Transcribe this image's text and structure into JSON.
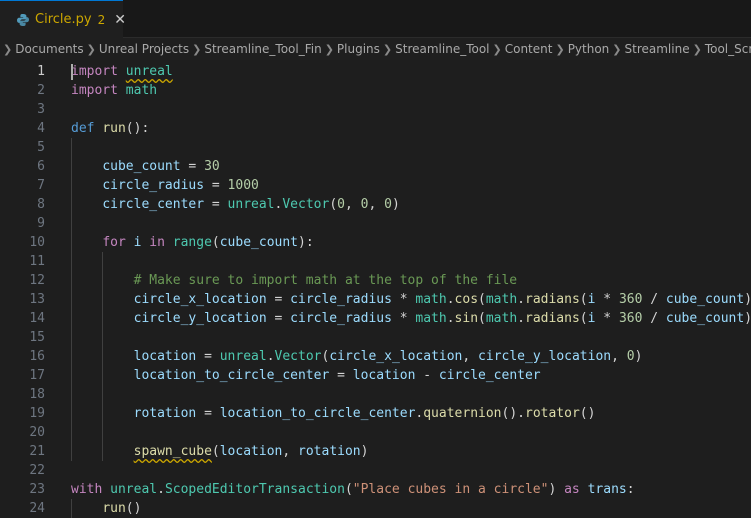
{
  "tab": {
    "filename": "Circle.py",
    "problem_count": "2",
    "close_glyph": "✕",
    "icon": "python-icon"
  },
  "breadcrumb": [
    "Documents",
    "Unreal Projects",
    "Streamline_Tool_Fin",
    "Plugins",
    "Streamline_Tool",
    "Content",
    "Python",
    "Streamline",
    "Tool_Script_I"
  ],
  "colors": {
    "keyword": "#c586c0",
    "def": "#569cd6",
    "function": "#dcdcaa",
    "variable": "#9cdcfe",
    "number": "#b5cea8",
    "string": "#ce9178",
    "comment": "#6a9955",
    "module": "#4ec9b0",
    "warning": "#cca700"
  },
  "lines": [
    {
      "no": "1",
      "indent": 0,
      "tokens": [
        [
          "k",
          "import"
        ],
        [
          "t",
          " "
        ],
        [
          "m",
          "unreal",
          "sq"
        ]
      ]
    },
    {
      "no": "2",
      "indent": 0,
      "tokens": [
        [
          "k",
          "import"
        ],
        [
          "t",
          " "
        ],
        [
          "m",
          "math"
        ]
      ]
    },
    {
      "no": "3",
      "indent": 0,
      "tokens": []
    },
    {
      "no": "4",
      "indent": 0,
      "tokens": [
        [
          "kd",
          "def"
        ],
        [
          "t",
          " "
        ],
        [
          "f",
          "run"
        ],
        [
          "t",
          "():"
        ]
      ]
    },
    {
      "no": "5",
      "indent": 1,
      "tokens": []
    },
    {
      "no": "6",
      "indent": 1,
      "tokens": [
        [
          "v",
          "cube_count"
        ],
        [
          "t",
          " = "
        ],
        [
          "n",
          "30"
        ]
      ]
    },
    {
      "no": "7",
      "indent": 1,
      "tokens": [
        [
          "v",
          "circle_radius"
        ],
        [
          "t",
          " = "
        ],
        [
          "n",
          "1000"
        ]
      ]
    },
    {
      "no": "8",
      "indent": 1,
      "tokens": [
        [
          "v",
          "circle_center"
        ],
        [
          "t",
          " = "
        ],
        [
          "m",
          "unreal"
        ],
        [
          "t",
          "."
        ],
        [
          "m",
          "Vector"
        ],
        [
          "t",
          "("
        ],
        [
          "n",
          "0"
        ],
        [
          "t",
          ", "
        ],
        [
          "n",
          "0"
        ],
        [
          "t",
          ", "
        ],
        [
          "n",
          "0"
        ],
        [
          "t",
          ")"
        ]
      ]
    },
    {
      "no": "9",
      "indent": 1,
      "tokens": []
    },
    {
      "no": "10",
      "indent": 1,
      "tokens": [
        [
          "k",
          "for"
        ],
        [
          "t",
          " "
        ],
        [
          "v",
          "i"
        ],
        [
          "t",
          " "
        ],
        [
          "k",
          "in"
        ],
        [
          "t",
          " "
        ],
        [
          "m",
          "range"
        ],
        [
          "t",
          "("
        ],
        [
          "v",
          "cube_count"
        ],
        [
          "t",
          "):"
        ]
      ]
    },
    {
      "no": "11",
      "indent": 2,
      "tokens": []
    },
    {
      "no": "12",
      "indent": 2,
      "tokens": [
        [
          "c",
          "# Make sure to import math at the top of the file"
        ]
      ]
    },
    {
      "no": "13",
      "indent": 2,
      "tokens": [
        [
          "v",
          "circle_x_location"
        ],
        [
          "t",
          " = "
        ],
        [
          "v",
          "circle_radius"
        ],
        [
          "t",
          " * "
        ],
        [
          "m",
          "math"
        ],
        [
          "t",
          "."
        ],
        [
          "f",
          "cos"
        ],
        [
          "t",
          "("
        ],
        [
          "m",
          "math"
        ],
        [
          "t",
          "."
        ],
        [
          "f",
          "radians"
        ],
        [
          "t",
          "("
        ],
        [
          "v",
          "i"
        ],
        [
          "t",
          " * "
        ],
        [
          "n",
          "360"
        ],
        [
          "t",
          " / "
        ],
        [
          "v",
          "cube_count"
        ],
        [
          "t",
          "))"
        ]
      ]
    },
    {
      "no": "14",
      "indent": 2,
      "tokens": [
        [
          "v",
          "circle_y_location"
        ],
        [
          "t",
          " = "
        ],
        [
          "v",
          "circle_radius"
        ],
        [
          "t",
          " * "
        ],
        [
          "m",
          "math"
        ],
        [
          "t",
          "."
        ],
        [
          "f",
          "sin"
        ],
        [
          "t",
          "("
        ],
        [
          "m",
          "math"
        ],
        [
          "t",
          "."
        ],
        [
          "f",
          "radians"
        ],
        [
          "t",
          "("
        ],
        [
          "v",
          "i"
        ],
        [
          "t",
          " * "
        ],
        [
          "n",
          "360"
        ],
        [
          "t",
          " / "
        ],
        [
          "v",
          "cube_count"
        ],
        [
          "t",
          "))"
        ]
      ]
    },
    {
      "no": "15",
      "indent": 2,
      "tokens": []
    },
    {
      "no": "16",
      "indent": 2,
      "tokens": [
        [
          "v",
          "location"
        ],
        [
          "t",
          " = "
        ],
        [
          "m",
          "unreal"
        ],
        [
          "t",
          "."
        ],
        [
          "m",
          "Vector"
        ],
        [
          "t",
          "("
        ],
        [
          "v",
          "circle_x_location"
        ],
        [
          "t",
          ", "
        ],
        [
          "v",
          "circle_y_location"
        ],
        [
          "t",
          ", "
        ],
        [
          "n",
          "0"
        ],
        [
          "t",
          ")"
        ]
      ]
    },
    {
      "no": "17",
      "indent": 2,
      "tokens": [
        [
          "v",
          "location_to_circle_center"
        ],
        [
          "t",
          " = "
        ],
        [
          "v",
          "location"
        ],
        [
          "t",
          " - "
        ],
        [
          "v",
          "circle_center"
        ]
      ]
    },
    {
      "no": "18",
      "indent": 2,
      "tokens": []
    },
    {
      "no": "19",
      "indent": 2,
      "tokens": [
        [
          "v",
          "rotation"
        ],
        [
          "t",
          " = "
        ],
        [
          "v",
          "location_to_circle_center"
        ],
        [
          "t",
          "."
        ],
        [
          "f",
          "quaternion"
        ],
        [
          "t",
          "()."
        ],
        [
          "f",
          "rotator"
        ],
        [
          "t",
          "()"
        ]
      ]
    },
    {
      "no": "20",
      "indent": 2,
      "tokens": []
    },
    {
      "no": "21",
      "indent": 2,
      "tokens": [
        [
          "f",
          "spawn_cube",
          "sq"
        ],
        [
          "t",
          "("
        ],
        [
          "v",
          "location"
        ],
        [
          "t",
          ", "
        ],
        [
          "v",
          "rotation"
        ],
        [
          "t",
          ")"
        ]
      ]
    },
    {
      "no": "22",
      "indent": 0,
      "tokens": []
    },
    {
      "no": "23",
      "indent": 0,
      "tokens": [
        [
          "k",
          "with"
        ],
        [
          "t",
          " "
        ],
        [
          "m",
          "unreal"
        ],
        [
          "t",
          "."
        ],
        [
          "m",
          "ScopedEditorTransaction"
        ],
        [
          "t",
          "("
        ],
        [
          "s",
          "\"Place cubes in a circle\""
        ],
        [
          "t",
          ") "
        ],
        [
          "k",
          "as"
        ],
        [
          "t",
          " "
        ],
        [
          "v",
          "trans"
        ],
        [
          "t",
          ":"
        ]
      ]
    },
    {
      "no": "24",
      "indent": 1,
      "tokens": [
        [
          "f",
          "run"
        ],
        [
          "t",
          "()"
        ]
      ]
    }
  ]
}
